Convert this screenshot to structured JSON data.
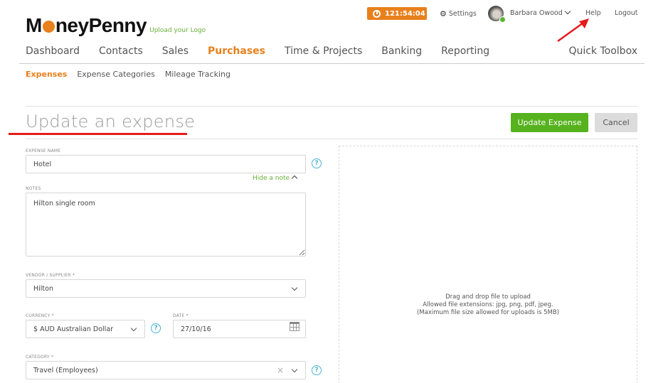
{
  "brand": {
    "logo_text_before": "M",
    "logo_text_after": "neyPenny",
    "upload_logo": "Upload your Logo",
    "accent_color": "#e8801c",
    "green_color": "#56b21d"
  },
  "topbar": {
    "timer": "121:54:04",
    "settings": "Settings",
    "user_name": "Barbara Owood",
    "help": "Help",
    "logout": "Logout"
  },
  "main_nav": {
    "items": [
      {
        "label": "Dashboard",
        "active": false
      },
      {
        "label": "Contacts",
        "active": false
      },
      {
        "label": "Sales",
        "active": false
      },
      {
        "label": "Purchases",
        "active": true
      },
      {
        "label": "Time & Projects",
        "active": false
      },
      {
        "label": "Banking",
        "active": false
      },
      {
        "label": "Reporting",
        "active": false
      }
    ],
    "quick_toolbox": "Quick Toolbox"
  },
  "sub_nav": {
    "items": [
      {
        "label": "Expenses",
        "active": true
      },
      {
        "label": "Expense Categories",
        "active": false
      },
      {
        "label": "Mileage Tracking",
        "active": false
      }
    ]
  },
  "page": {
    "title": "Update an expense",
    "update_button": "Update Expense",
    "cancel_button": "Cancel"
  },
  "form": {
    "expense_name": {
      "label": "EXPENSE NAME",
      "value": "Hotel"
    },
    "hide_note": "Hide a note",
    "notes": {
      "label": "NOTES",
      "value": "Hilton single room"
    },
    "vendor": {
      "label": "VENDOR / SUPPLIER *",
      "value": "Hilton"
    },
    "currency": {
      "label": "CURRENCY *",
      "value": "$ AUD Australian Dollar"
    },
    "date": {
      "label": "DATE *",
      "value": "27/10/16"
    },
    "category": {
      "label": "CATEGORY *",
      "value": "Travel (Employees)"
    },
    "help_glyph": "?"
  },
  "upload": {
    "line1": "Drag and drop file to upload",
    "line2": "Allowed file extensions: jpg, png, pdf, jpeg.",
    "line3": "(Maximum file size allowed for uploads is 5MB)"
  }
}
